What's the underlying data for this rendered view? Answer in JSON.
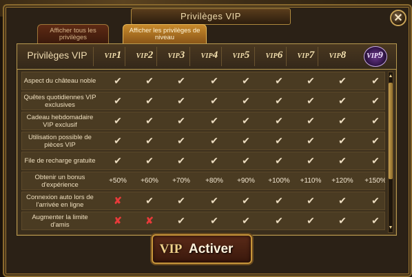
{
  "window": {
    "title": "Privilèges VIP",
    "close_label": "✕"
  },
  "tabs": [
    {
      "label": "Afficher tous les privilèges",
      "active": false
    },
    {
      "label": "Afficher les privilèges de niveau",
      "active": true
    }
  ],
  "table": {
    "header_label": "Privilèges VIP",
    "vip_levels": [
      {
        "prefix": "VIP",
        "num": "1"
      },
      {
        "prefix": "VIP",
        "num": "2"
      },
      {
        "prefix": "VIP",
        "num": "3"
      },
      {
        "prefix": "VIP",
        "num": "4"
      },
      {
        "prefix": "VIP",
        "num": "5"
      },
      {
        "prefix": "VIP",
        "num": "6"
      },
      {
        "prefix": "VIP",
        "num": "7"
      },
      {
        "prefix": "VIP",
        "num": "8"
      },
      {
        "prefix": "VIP",
        "num": "9"
      }
    ],
    "rows": [
      {
        "label": "Aspect du château noble",
        "cells": [
          "✔",
          "✔",
          "✔",
          "✔",
          "✔",
          "✔",
          "✔",
          "✔",
          "✔"
        ]
      },
      {
        "label": "Quêtes quotidiennes VIP exclusives",
        "cells": [
          "✔",
          "✔",
          "✔",
          "✔",
          "✔",
          "✔",
          "✔",
          "✔",
          "✔"
        ]
      },
      {
        "label": "Cadeau hebdomadaire VIP exclusif",
        "cells": [
          "✔",
          "✔",
          "✔",
          "✔",
          "✔",
          "✔",
          "✔",
          "✔",
          "✔"
        ]
      },
      {
        "label": "Utilisation possible de pièces VIP",
        "cells": [
          "✔",
          "✔",
          "✔",
          "✔",
          "✔",
          "✔",
          "✔",
          "✔",
          "✔"
        ]
      },
      {
        "label": "File de recharge gratuite",
        "cells": [
          "✔",
          "✔",
          "✔",
          "✔",
          "✔",
          "✔",
          "✔",
          "✔",
          "✔"
        ]
      },
      {
        "label": "Obtenir un bonus d'expérience",
        "cells": [
          "+50%",
          "+60%",
          "+70%",
          "+80%",
          "+90%",
          "+100%",
          "+110%",
          "+120%",
          "+150%"
        ]
      },
      {
        "label": "Connexion auto lors de l'arrivée en ligne",
        "cells": [
          "✘",
          "✔",
          "✔",
          "✔",
          "✔",
          "✔",
          "✔",
          "✔",
          "✔"
        ]
      },
      {
        "label": "Augmenter la limite d'amis",
        "cells": [
          "✘",
          "✘",
          "✔",
          "✔",
          "✔",
          "✔",
          "✔",
          "✔",
          "✔"
        ]
      }
    ]
  },
  "scrollbar": {
    "up": "▲",
    "down": "▼"
  },
  "activate_button": {
    "badge": "VIP",
    "label": "Activer"
  }
}
